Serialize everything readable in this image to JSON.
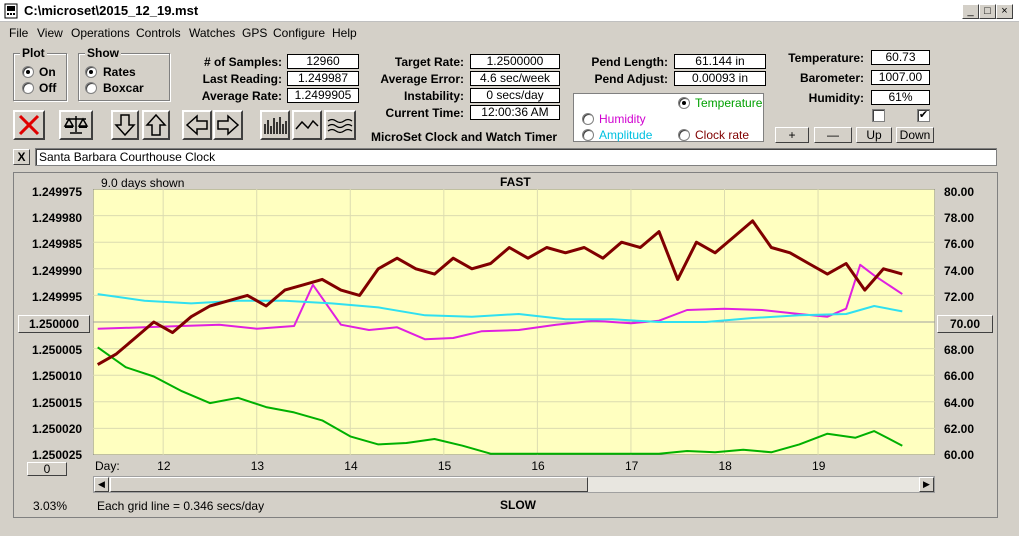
{
  "window": {
    "title": "C:\\microset\\2015_12_19.mst",
    "minimize": "_",
    "maximize": "□",
    "close": "×"
  },
  "menu": [
    "File",
    "View",
    "Operations",
    "Controls",
    "Watches",
    "GPS",
    "Configure",
    "Help"
  ],
  "plot_group": {
    "title": "Plot",
    "options": [
      {
        "label": "On",
        "selected": true
      },
      {
        "label": "Off",
        "selected": false
      }
    ]
  },
  "show_group": {
    "title": "Show",
    "options": [
      {
        "label": "Rates",
        "selected": true
      },
      {
        "label": "Boxcar",
        "selected": false
      }
    ]
  },
  "stats": {
    "samples_label": "# of Samples:",
    "samples": "12960",
    "last_reading_label": "Last Reading:",
    "last_reading": "1.249987",
    "avg_rate_label": "Average Rate:",
    "avg_rate": "1.2499905",
    "target_rate_label": "Target Rate:",
    "target_rate": "1.2500000",
    "avg_error_label": "Average Error:",
    "avg_error": "4.6 sec/week",
    "instability_label": "Instability:",
    "instability": "0 secs/day",
    "current_time_label": "Current Time:",
    "current_time": "12:00:36 AM",
    "pend_length_label": "Pend Length:",
    "pend_length": "61.144 in",
    "pend_adjust_label": "Pend Adjust:",
    "pend_adjust": "0.00093 in",
    "temperature_label": "Temperature:",
    "temperature": "60.73",
    "barometer_label": "Barometer:",
    "barometer": "1007.00",
    "humidity_label": "Humidity:",
    "humidity": "61%"
  },
  "app_name": "MicroSet Clock and Watch Timer",
  "overlay_options": [
    {
      "label": "Temperature",
      "selected": true,
      "color": "#00a000"
    },
    {
      "label": "Humidity",
      "selected": false,
      "color": "#d000d0"
    },
    {
      "label": "Amplitude",
      "selected": false,
      "color": "#00c0e0"
    },
    {
      "label": "Clock rate",
      "selected": false,
      "color": "#800000"
    }
  ],
  "scale_buttons": {
    "plus": "+",
    "minus": "—",
    "up": "Up",
    "down": "Down"
  },
  "checkboxes": [
    {
      "checked": false
    },
    {
      "checked": true
    }
  ],
  "clock_name": "Santa Barbara Courthouse Clock",
  "clear_name_button": "X",
  "plot": {
    "days_shown": "9.0 days shown",
    "fast_label": "FAST",
    "slow_label": "SLOW",
    "center_value": "1.250000",
    "right_center_value": "70.00",
    "bottom_left_button": "0",
    "percent": "3.03%",
    "grid_note": "Each grid line = 0.346 secs/day",
    "day_prefix": "Day:"
  },
  "colors": {
    "plot_bg": "#ffffc0",
    "rate": "#800000",
    "temperature": "#00b000",
    "humidity": "#e020e0",
    "amplitude": "#30e0f0"
  },
  "chart_data": {
    "type": "line",
    "title": "",
    "xlabel": "Day:",
    "x_range": [
      11.25,
      20.25
    ],
    "x_ticks": [
      12,
      13,
      14,
      15,
      16,
      17,
      18,
      19
    ],
    "left_axis": {
      "range": [
        1.249975,
        1.250025
      ],
      "inverted": true,
      "ticks": [
        "1.249975",
        "1.249980",
        "1.249985",
        "1.249990",
        "1.249995",
        "1.250000",
        "1.250005",
        "1.250010",
        "1.250015",
        "1.250020",
        "1.250025"
      ]
    },
    "right_axis": {
      "range": [
        60,
        80
      ],
      "ticks": [
        "80.00",
        "78.00",
        "76.00",
        "74.00",
        "72.00",
        "70.00",
        "68.00",
        "66.00",
        "64.00",
        "62.00",
        "60.00"
      ]
    },
    "grid": true,
    "series": [
      {
        "color": "#800000",
        "axis": "left",
        "x": [
          11.3,
          11.5,
          11.7,
          11.9,
          12.1,
          12.3,
          12.5,
          12.7,
          12.9,
          13.1,
          13.3,
          13.5,
          13.7,
          13.9,
          14.1,
          14.3,
          14.5,
          14.7,
          14.9,
          15.1,
          15.3,
          15.5,
          15.7,
          15.9,
          16.1,
          16.3,
          16.5,
          16.7,
          16.9,
          17.1,
          17.3,
          17.5,
          17.7,
          17.9,
          18.1,
          18.3,
          18.5,
          18.7,
          18.9,
          19.1,
          19.3,
          19.5,
          19.7,
          19.9
        ],
        "y": [
          1.250008,
          1.250006,
          1.250003,
          1.25,
          1.250002,
          1.249999,
          1.249997,
          1.249996,
          1.249995,
          1.249997,
          1.249994,
          1.249993,
          1.249992,
          1.249994,
          1.249995,
          1.24999,
          1.249988,
          1.24999,
          1.249991,
          1.249988,
          1.24999,
          1.249989,
          1.249986,
          1.249988,
          1.249986,
          1.249987,
          1.249986,
          1.249988,
          1.249985,
          1.249986,
          1.249983,
          1.249992,
          1.249985,
          1.249987,
          1.249984,
          1.249981,
          1.249986,
          1.249987,
          1.249989,
          1.249991,
          1.249989,
          1.249994,
          1.24999,
          1.249991
        ]
      },
      {
        "color": "#00b000",
        "axis": "right",
        "x": [
          11.3,
          11.6,
          11.9,
          12.2,
          12.5,
          12.8,
          13.1,
          13.4,
          13.7,
          14.0,
          14.3,
          14.6,
          14.9,
          15.2,
          15.5,
          15.8,
          16.1,
          16.4,
          16.7,
          17.0,
          17.3,
          17.6,
          17.9,
          18.2,
          18.5,
          18.8,
          19.1,
          19.4,
          19.6,
          19.9
        ],
        "y": [
          68.1,
          66.6,
          65.9,
          64.8,
          63.9,
          64.3,
          63.6,
          63.2,
          62.6,
          61.4,
          60.8,
          60.9,
          61.2,
          60.7,
          60.1,
          60.1,
          60.1,
          60.1,
          60.1,
          60.1,
          60.1,
          60.3,
          60.2,
          60.4,
          60.2,
          60.8,
          61.6,
          61.3,
          61.8,
          60.7
        ]
      },
      {
        "color": "#e020e0",
        "axis": "right",
        "x": [
          11.3,
          11.8,
          12.2,
          12.6,
          13.0,
          13.4,
          13.6,
          13.9,
          14.2,
          14.5,
          14.8,
          15.1,
          15.4,
          15.8,
          16.2,
          16.6,
          17.0,
          17.3,
          17.6,
          18.0,
          18.4,
          18.8,
          19.1,
          19.3,
          19.45,
          19.6,
          19.9
        ],
        "y": [
          69.5,
          69.6,
          69.7,
          69.8,
          69.5,
          69.7,
          72.8,
          69.8,
          69.4,
          69.6,
          68.7,
          68.8,
          69.3,
          69.4,
          69.8,
          70.1,
          69.9,
          70.1,
          70.9,
          71.0,
          70.9,
          70.6,
          70.4,
          71.0,
          74.3,
          73.5,
          72.1
        ]
      },
      {
        "color": "#30e0f0",
        "axis": "right",
        "x": [
          11.3,
          11.8,
          12.3,
          12.8,
          13.3,
          13.8,
          14.3,
          14.8,
          15.3,
          15.8,
          16.3,
          16.8,
          17.3,
          17.8,
          18.3,
          18.8,
          19.3,
          19.6,
          19.9
        ],
        "y": [
          72.1,
          71.6,
          71.4,
          71.6,
          71.6,
          71.4,
          71.1,
          70.5,
          70.4,
          70.6,
          70.2,
          70.2,
          70.0,
          70.0,
          70.3,
          70.5,
          70.6,
          71.2,
          70.8
        ]
      }
    ]
  }
}
